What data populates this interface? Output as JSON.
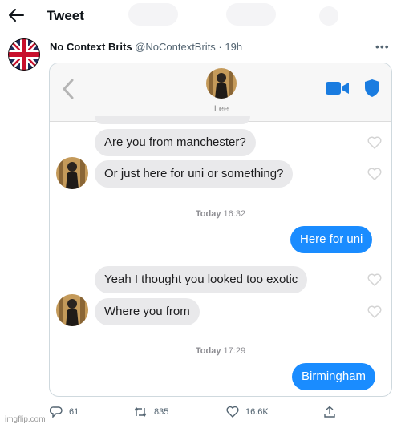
{
  "header": {
    "title": "Tweet"
  },
  "tweet": {
    "author_name": "No Context Brits",
    "author_handle": "@NoContextBrits",
    "separator": " · ",
    "time_ago": "19h",
    "more_icon": "more-icon"
  },
  "screenshot": {
    "contact_name": "Lee",
    "messages": [
      {
        "direction": "in",
        "text": "Are you from manchester?"
      },
      {
        "direction": "in",
        "text": "Or just here for uni or something?"
      },
      {
        "direction": "out",
        "text": "Here for uni"
      },
      {
        "direction": "in",
        "text": "Yeah I thought you looked too exotic"
      },
      {
        "direction": "in",
        "text": "Where you from"
      },
      {
        "direction": "out",
        "text": "Birmingham"
      }
    ],
    "timestamps": [
      {
        "day": "Today",
        "time": "16:32"
      },
      {
        "day": "Today",
        "time": "17:29"
      }
    ],
    "colors": {
      "outgoing": "#1a8cff",
      "incoming": "#e9e9eb",
      "accent": "#1a7ce0"
    }
  },
  "actions": {
    "replies": "61",
    "retweets": "835",
    "likes": "16.6K"
  },
  "watermark": "imgflip.com"
}
